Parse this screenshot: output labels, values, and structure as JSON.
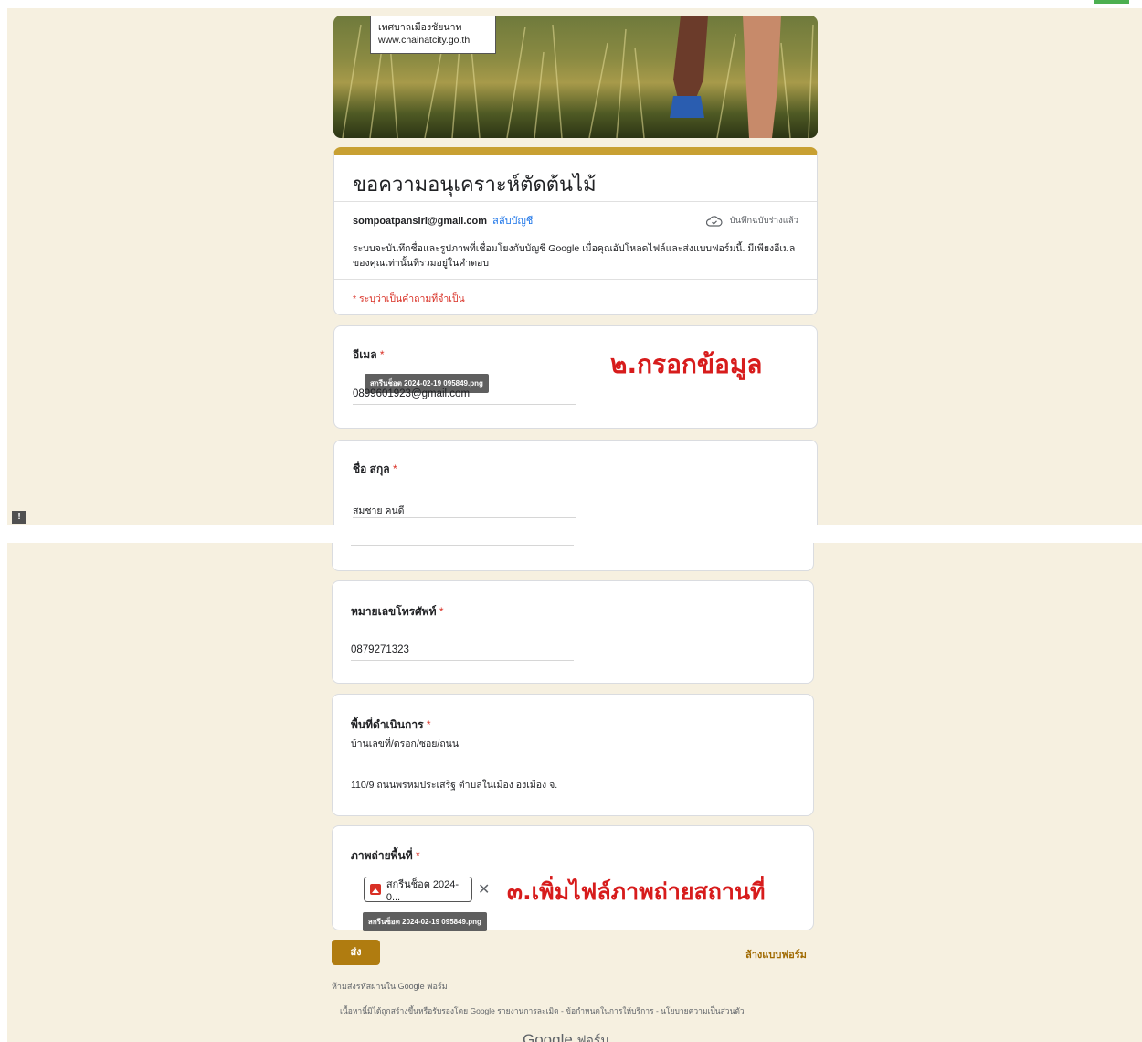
{
  "header_image": {
    "site_name": "เทศบาลเมืองชัยนาท",
    "site_url": "www.chainatcity.go.th"
  },
  "form": {
    "title": "ขอความอนุเคราะห์ตัดต้นไม้",
    "account_email": "sompoatpansiri@gmail.com",
    "switch_account": "สลับบัญชี",
    "saved_status": "บันทึกฉบับร่างแล้ว",
    "privacy_note": "ระบบจะบันทึกชื่อและรูปภาพที่เชื่อมโยงกับบัญชี Google เมื่อคุณอัปโหลดไฟล์และส่งแบบฟอร์มนี้. มีเพียงอีเมลของคุณเท่านั้นที่รวมอยู่ในคำตอบ",
    "required_note": "* ระบุว่าเป็นคำถามที่จำเป็น"
  },
  "fields": {
    "email": {
      "label": "อีเมล",
      "value": "0899601923@gmail.com",
      "tooltip": "สกรีนช็อต 2024-02-19 095849.png"
    },
    "name": {
      "label": "ชื่อ สกุล",
      "value": "สมชาย  คนดี"
    },
    "phone": {
      "label": "หมายเลขโทรศัพท์",
      "value": "0879271323"
    },
    "area": {
      "label": "พื้นที่ดำเนินการ",
      "sublabel": "บ้านเลขที่/ตรอก/ซอย/ถนน",
      "value": "110/9 ถนนพรหมประเสริฐ ตำบลในเมือง องเมือง จ."
    },
    "photo": {
      "label": "ภาพถ่ายพื้นที่",
      "file_chip": "สกรีนช็อต 2024-0...",
      "tooltip": "สกรีนช็อต 2024-02-19 095849.png"
    }
  },
  "required_star": "*",
  "annotations": {
    "step2": "๒.กรอกข้อมูล",
    "step3": "๓.เพิ่มไฟล์ภาพถ่ายสถานที่"
  },
  "actions": {
    "submit": "ส่ง",
    "clear": "ล้างแบบฟอร์ม"
  },
  "footer": {
    "never_password": "ห้ามส่งรหัสผ่านใน Google ฟอร์ม",
    "disclaimer": "เนื้อหานี้มิได้ถูกสร้างขึ้นหรือรับรองโดย Google",
    "report_abuse": "รายงานการละเมิด",
    "terms": "ข้อกำหนดในการให้บริการ",
    "privacy": "นโยบายความเป็นส่วนตัว",
    "sep": " - ",
    "brand_google": "Google",
    "brand_forms": "ฟอร์ม"
  },
  "feedback_icon": "!"
}
